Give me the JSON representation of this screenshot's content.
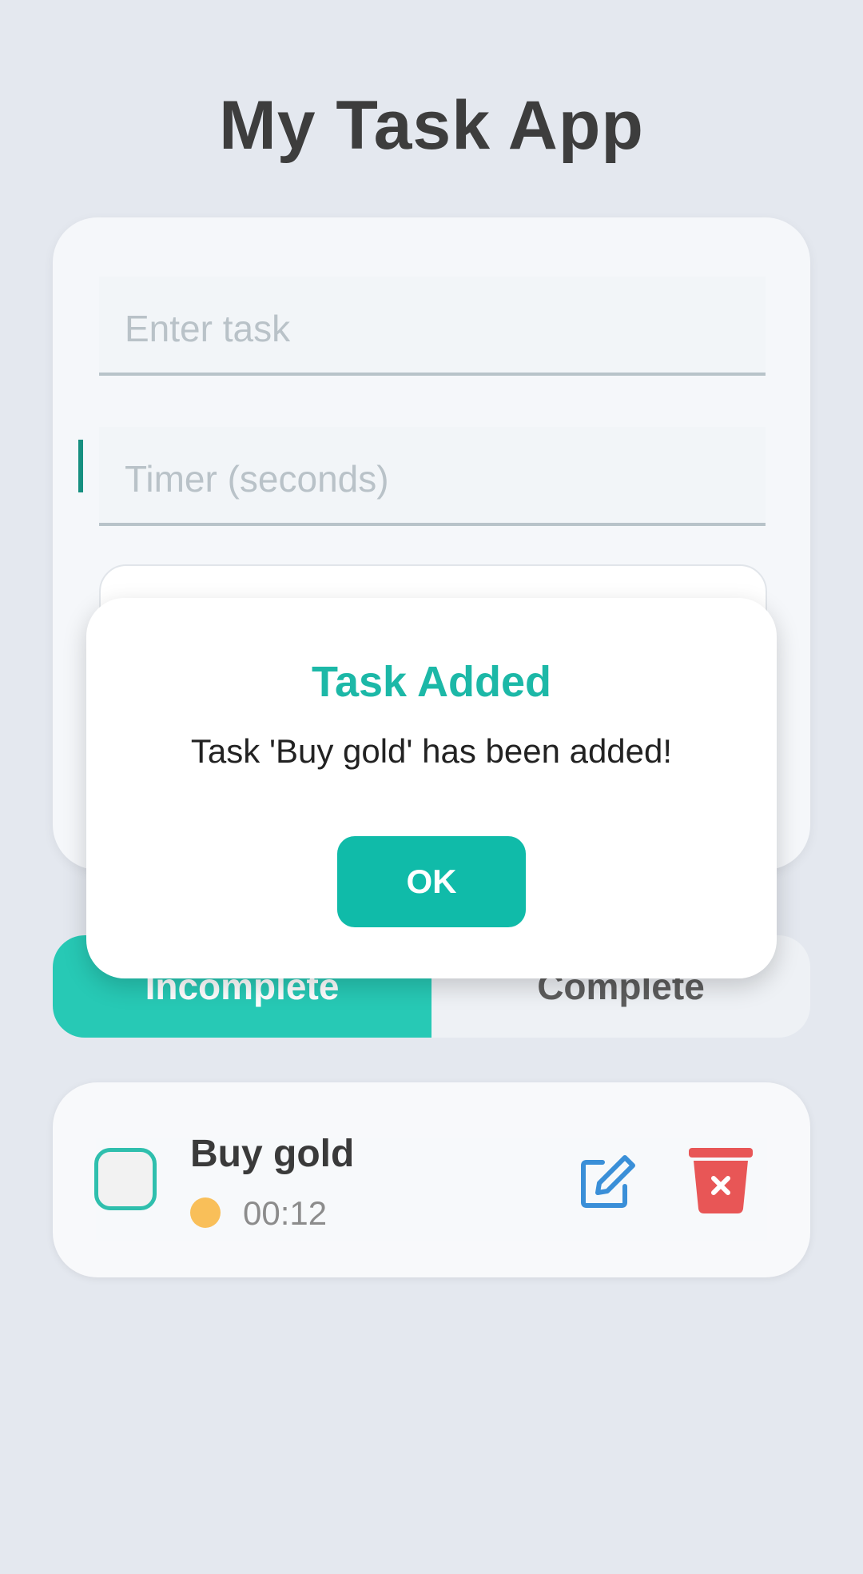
{
  "app": {
    "title": "My Task App"
  },
  "form": {
    "task_placeholder": "Enter task",
    "timer_placeholder": "Timer (seconds)"
  },
  "tabs": [
    {
      "label": "Incomplete",
      "selected": true
    },
    {
      "label": "Complete",
      "selected": false
    }
  ],
  "tasks": [
    {
      "name": "Buy gold",
      "timer": "00:12",
      "status_color": "#f9bf59",
      "completed": false
    }
  ],
  "dialog": {
    "title": "Task Added",
    "message": "Task 'Buy gold' has been added!",
    "ok_label": "OK"
  },
  "colors": {
    "accent": "#1cb8a7",
    "tab_active": "#27c9b5",
    "edit": "#3a8fd8",
    "delete": "#e85656",
    "background": "#e4e8ef"
  },
  "icons": {
    "edit": "edit-icon",
    "delete": "trash-icon"
  }
}
